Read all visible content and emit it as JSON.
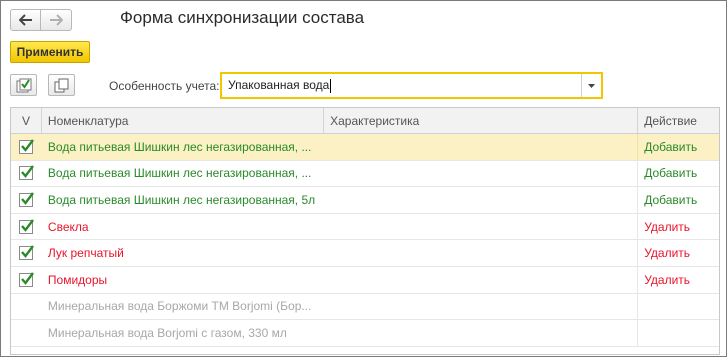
{
  "window": {
    "title": "Форма синхронизации состава"
  },
  "nav": {
    "back_icon": "arrow-left-icon",
    "forward_icon": "arrow-right-icon"
  },
  "toolbar": {
    "apply_label": "Применить",
    "check_all_icon": "check-all-icon",
    "copy_icon": "copy-icon"
  },
  "filter": {
    "label": "Особенность учета:",
    "value": "Упакованная вода"
  },
  "table": {
    "headers": {
      "check": "V",
      "item": "Номенклатура",
      "characteristic": "Характеристика",
      "action": "Действие"
    },
    "rows": [
      {
        "checked": true,
        "item": "Вода питьевая Шишкин лес негазированная, ...",
        "characteristic": "",
        "action": "Добавить",
        "kind": "add",
        "selected": true
      },
      {
        "checked": true,
        "item": "Вода питьевая Шишкин лес негазированная, ...",
        "characteristic": "",
        "action": "Добавить",
        "kind": "add",
        "selected": false
      },
      {
        "checked": true,
        "item": "Вода питьевая Шишкин лес негазированная, 5л",
        "characteristic": "",
        "action": "Добавить",
        "kind": "add",
        "selected": false
      },
      {
        "checked": true,
        "item": "Свекла",
        "characteristic": "",
        "action": "Удалить",
        "kind": "del",
        "selected": false
      },
      {
        "checked": true,
        "item": "Лук репчатый",
        "characteristic": "",
        "action": "Удалить",
        "kind": "del",
        "selected": false
      },
      {
        "checked": true,
        "item": "Помидоры",
        "characteristic": "",
        "action": "Удалить",
        "kind": "del",
        "selected": false
      },
      {
        "checked": false,
        "item": "Минеральная вода Боржоми ТМ Borjomi (Бор...",
        "characteristic": "",
        "action": "",
        "kind": "dim",
        "selected": false
      },
      {
        "checked": false,
        "item": "Минеральная вода Borjomi с газом, 330 мл",
        "characteristic": "",
        "action": "",
        "kind": "dim",
        "selected": false
      }
    ]
  },
  "colors": {
    "accent": "#f2c600",
    "add": "#2a8a2a",
    "delete": "#e8142b",
    "disabled": "#a8a8a8",
    "selected_row": "#fbf1c4"
  }
}
